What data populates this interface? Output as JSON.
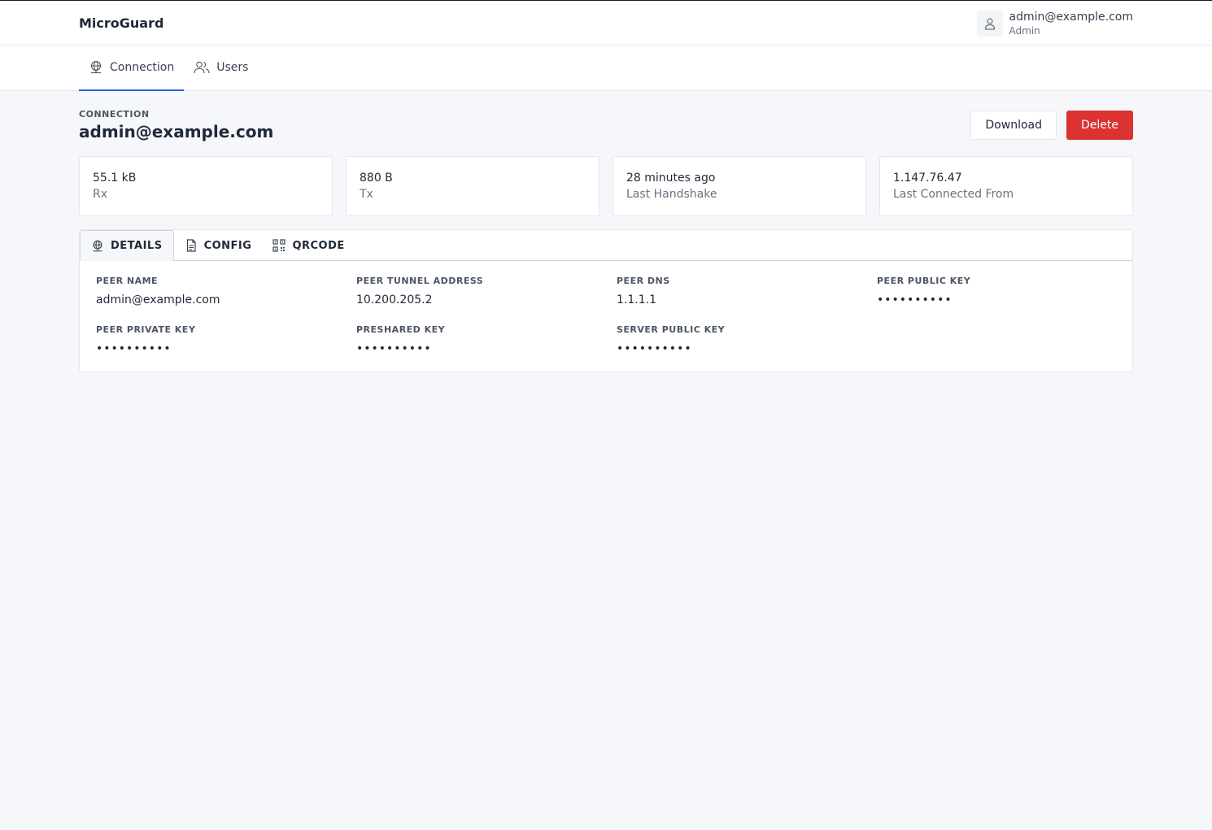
{
  "app": {
    "brand": "MicroGuard"
  },
  "user": {
    "email": "admin@example.com",
    "role": "Admin",
    "icon": "user-icon"
  },
  "nav": {
    "tabs": [
      {
        "label": "Connection",
        "icon": "globe-icon",
        "active": true
      },
      {
        "label": "Users",
        "icon": "users-icon",
        "active": false
      }
    ]
  },
  "connection": {
    "section_label": "CONNECTION",
    "title": "admin@example.com",
    "download_label": "Download",
    "delete_label": "Delete"
  },
  "stats": [
    {
      "value": "55.1 kB",
      "label": "Rx"
    },
    {
      "value": "880 B",
      "label": "Tx"
    },
    {
      "value": "28 minutes ago",
      "label": "Last Handshake"
    },
    {
      "value": "1.147.76.47",
      "label": "Last Connected From"
    }
  ],
  "panel": {
    "tabs": [
      {
        "label": "DETAILS",
        "icon": "globe-icon",
        "active": true
      },
      {
        "label": "CONFIG",
        "icon": "document-icon",
        "active": false
      },
      {
        "label": "QRCODE",
        "icon": "qrcode-icon",
        "active": false
      }
    ],
    "fields": [
      {
        "label": "PEER NAME",
        "value": "admin@example.com"
      },
      {
        "label": "PEER TUNNEL ADDRESS",
        "value": "10.200.205.2"
      },
      {
        "label": "PEER DNS",
        "value": "1.1.1.1"
      },
      {
        "label": "PEER PUBLIC KEY",
        "value": "••••••••••"
      },
      {
        "label": "PEER PRIVATE KEY",
        "value": "••••••••••"
      },
      {
        "label": "PRESHARED KEY",
        "value": "••••••••••"
      },
      {
        "label": "SERVER PUBLIC KEY",
        "value": "••••••••••"
      }
    ]
  },
  "colors": {
    "accent": "#2563eb",
    "danger": "#dc3232",
    "background": "#f5f7fa"
  }
}
